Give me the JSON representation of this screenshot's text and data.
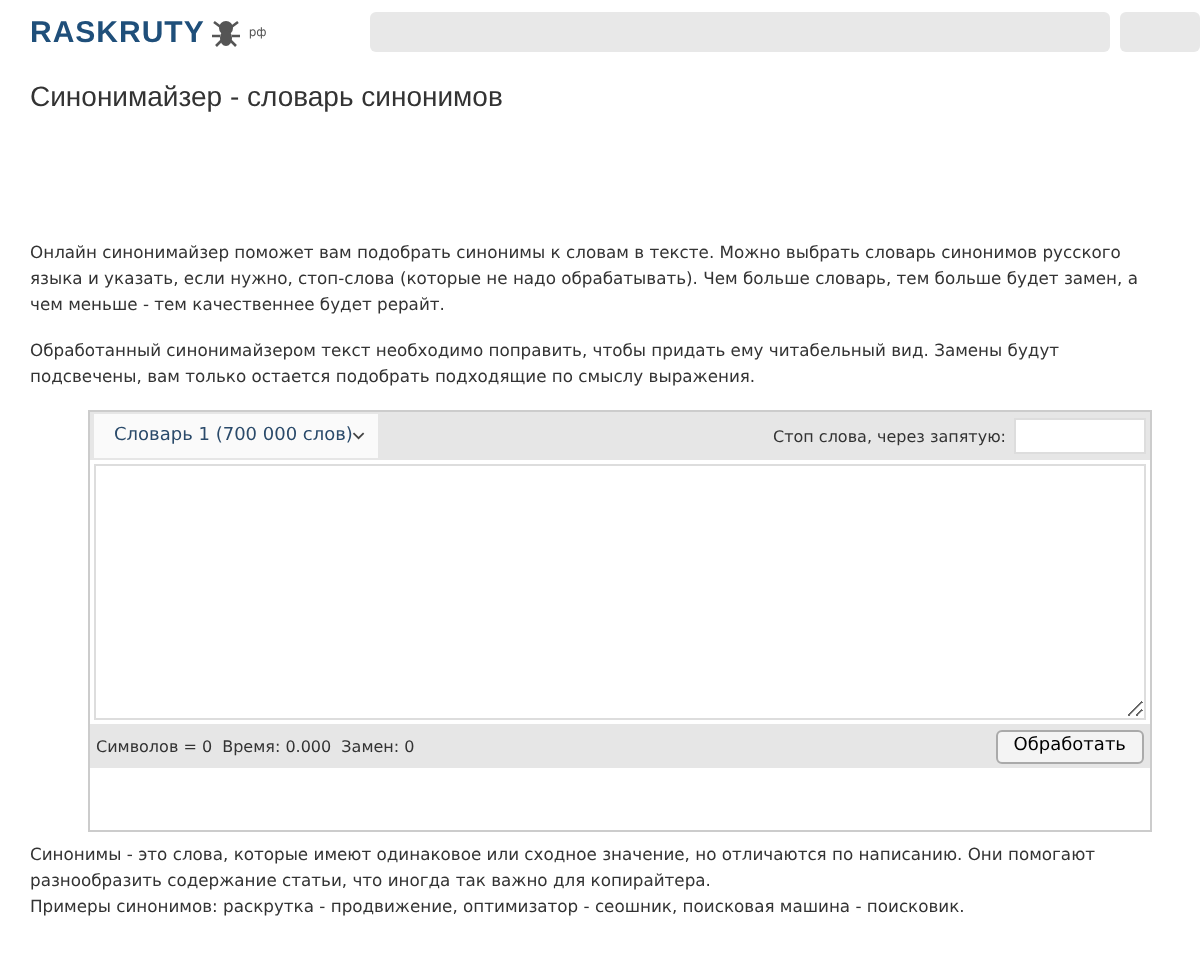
{
  "header": {
    "logo": "RASKRUTY",
    "logo_suffix": "рф"
  },
  "title": "Синонимайзер - словарь синонимов",
  "intro": [
    "Онлайн синонимайзер поможет вам подобрать синонимы к словам в тексте. Можно выбрать словарь синонимов русского языка и указать, если нужно, стоп-слова (которые не надо обрабатывать). Чем больше словарь, тем больше будет замен, а чем меньше - тем качественнее будет рерайт.",
    "Обработанный синонимайзером текст необходимо поправить, чтобы придать ему читабельный вид. Замены будут подсвечены, вам только остается подобрать подходящие по смыслу выражения."
  ],
  "tool": {
    "dictionary": "Словарь 1 (700 000 слов)",
    "stopwords_label": "Стоп слова, через запятую:",
    "stats": "Символов = 0  Время: 0.000  Замен: 0",
    "button": "Обработать"
  },
  "outro": [
    "Синонимы - это слова, которые имеют одинаковое или сходное значение, но отличаются по написанию. Они помогают разнообразить содержание статьи, что иногда так важно для копирайтера.",
    "Примеры синонимов: раскрутка - продвижение, оптимизатор - сеошник, поисковая машина - поисковик."
  ]
}
